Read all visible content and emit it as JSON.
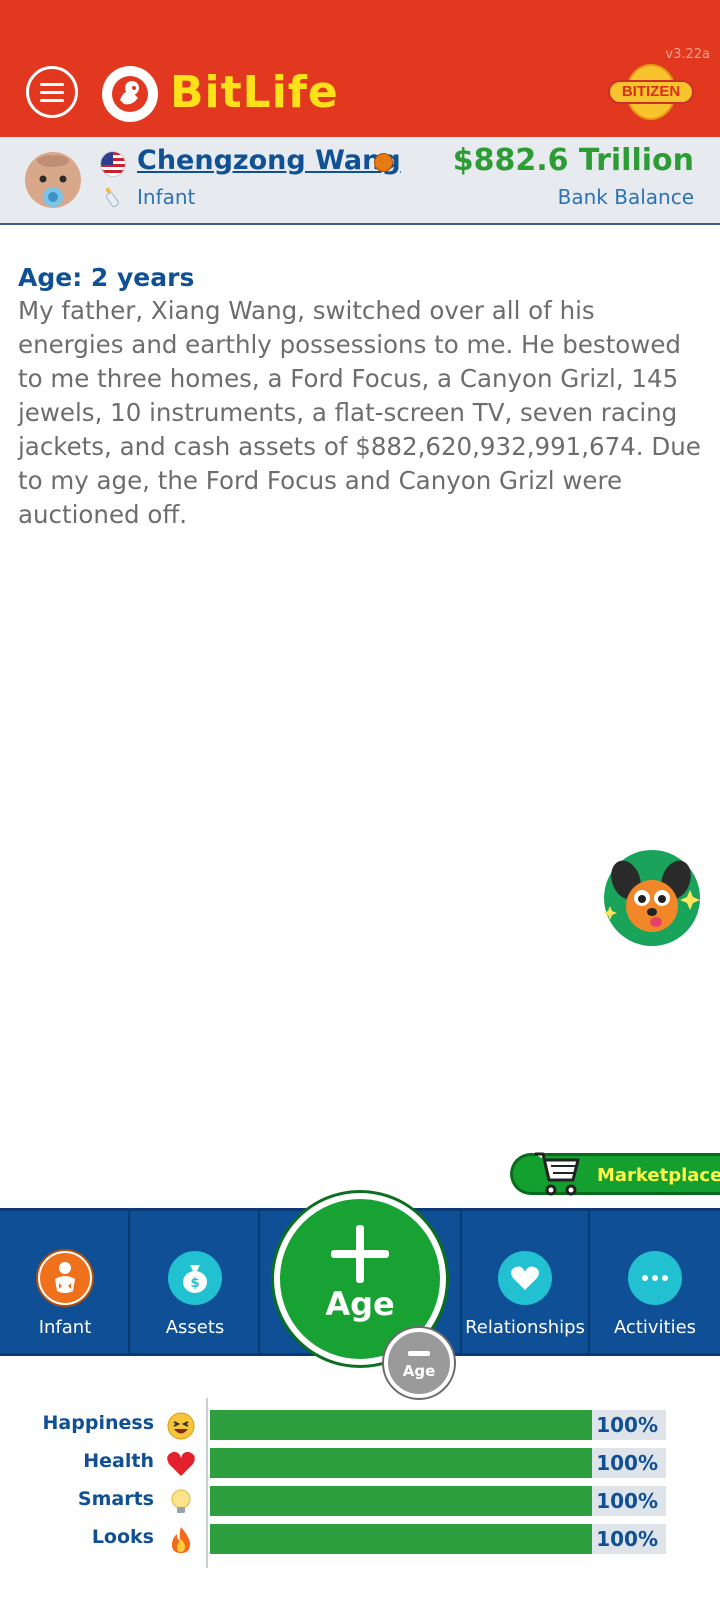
{
  "app": {
    "name": "BitLife",
    "version": "v3.22a",
    "bitizen_label": "BITIZEN"
  },
  "profile": {
    "name": "Chengzong Wang",
    "stage": "Infant",
    "balance": "$882.6 Trillion",
    "balance_label": "Bank Balance",
    "flag_icon": "us-flag-icon",
    "interest_icon": "basketball-icon"
  },
  "log": {
    "age_heading": "Age: 2 years",
    "text": "My father, Xiang Wang, switched over all of his energies and earthly possessions to me. He bestowed to me three homes, a Ford Focus, a Canyon Grizl, 145 jewels, 10 instruments, a flat-screen TV, seven racing jackets, and cash assets of $882,620,932,991,674. Due to my age, the Ford Focus and Canyon Grizl were auctioned off."
  },
  "marketplace": {
    "label": "Marketplace"
  },
  "nav": {
    "items": [
      {
        "label": "Infant",
        "icon": "baby-icon"
      },
      {
        "label": "Assets",
        "icon": "money-bag-icon"
      },
      {
        "label": "Relationships",
        "icon": "heart-icon"
      },
      {
        "label": "Activities",
        "icon": "more-icon"
      }
    ],
    "age_label": "Age",
    "age_minus_label": "Age"
  },
  "stats": [
    {
      "label": "Happiness",
      "value": 100,
      "display": "100%",
      "icon": "laughing-face-icon"
    },
    {
      "label": "Health",
      "value": 100,
      "display": "100%",
      "icon": "heart-icon"
    },
    {
      "label": "Smarts",
      "value": 100,
      "display": "100%",
      "icon": "lightbulb-icon"
    },
    {
      "label": "Looks",
      "value": 100,
      "display": "100%",
      "icon": "fire-icon"
    }
  ],
  "colors": {
    "header_red": "#e2381f",
    "logo_yellow": "#ffe11a",
    "primary_blue": "#0f4f95",
    "money_green": "#2d9c35",
    "stat_green": "#2e9f3f",
    "nav_cyan": "#21c1d1"
  }
}
